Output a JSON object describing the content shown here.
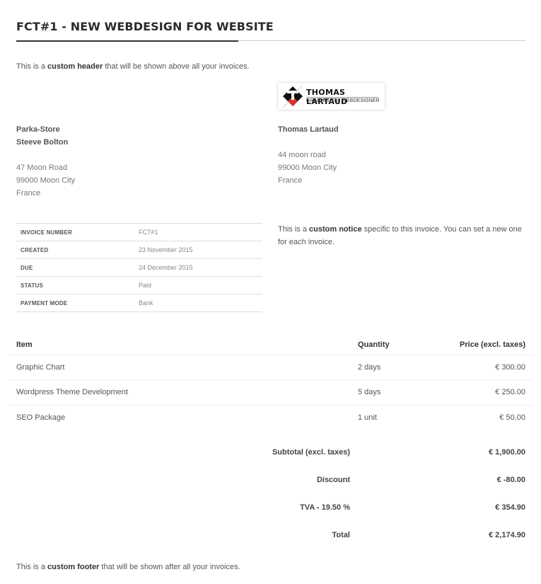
{
  "invoice": {
    "title": "FCT#1 - NEW WEBDESIGN FOR WEBSITE",
    "header_text": {
      "before": "This is a ",
      "bold": "custom header",
      "after": " that will be shown above all your invoices."
    },
    "logo": {
      "name": "THOMAS LARTAUD",
      "subtitle": "GRAPHISTE & WEBDESIGNER",
      "colors": {
        "black": "#111111",
        "red": "#d9322f"
      }
    },
    "client": {
      "company": "Parka-Store",
      "contact": "Steeve Bolton",
      "address": [
        "47 Moon Road",
        "99000 Moon City",
        "France"
      ]
    },
    "sender": {
      "name": "Thomas Lartaud",
      "address": [
        "44 moon road",
        "99000 Moon City",
        "France"
      ]
    },
    "meta": [
      {
        "label": "INVOICE NUMBER",
        "value": "FCT#1"
      },
      {
        "label": "CREATED",
        "value": "23 November 2015"
      },
      {
        "label": "DUE",
        "value": "24 December 2015"
      },
      {
        "label": "STATUS",
        "value": "Paid"
      },
      {
        "label": "PAYMENT MODE",
        "value": "Bank"
      }
    ],
    "notice": {
      "before": "This is a ",
      "bold": "custom notice",
      "after": " specific to this invoice. You can set a new one for each invoice."
    },
    "items_table": {
      "headers": {
        "item": "Item",
        "quantity": "Quantity",
        "price": "Price (excl. taxes)"
      },
      "rows": [
        {
          "item": "Graphic Chart",
          "quantity": "2 days",
          "price": "€ 300.00"
        },
        {
          "item": "Wordpress Theme Development",
          "quantity": "5 days",
          "price": "€ 250.00"
        },
        {
          "item": "SEO Package",
          "quantity": "1 unit",
          "price": "€ 50.00"
        }
      ]
    },
    "totals": [
      {
        "label": "Subtotal (excl. taxes)",
        "value": "€ 1,900.00"
      },
      {
        "label": "Discount",
        "value": "€ -80.00"
      },
      {
        "label": "TVA - 19.50 %",
        "value": "€ 354.90"
      },
      {
        "label": "Total",
        "value": "€ 2,174.90"
      }
    ],
    "footer_text": {
      "before": "This is a ",
      "bold": "custom footer",
      "after": " that will be shown after all your invoices."
    }
  }
}
